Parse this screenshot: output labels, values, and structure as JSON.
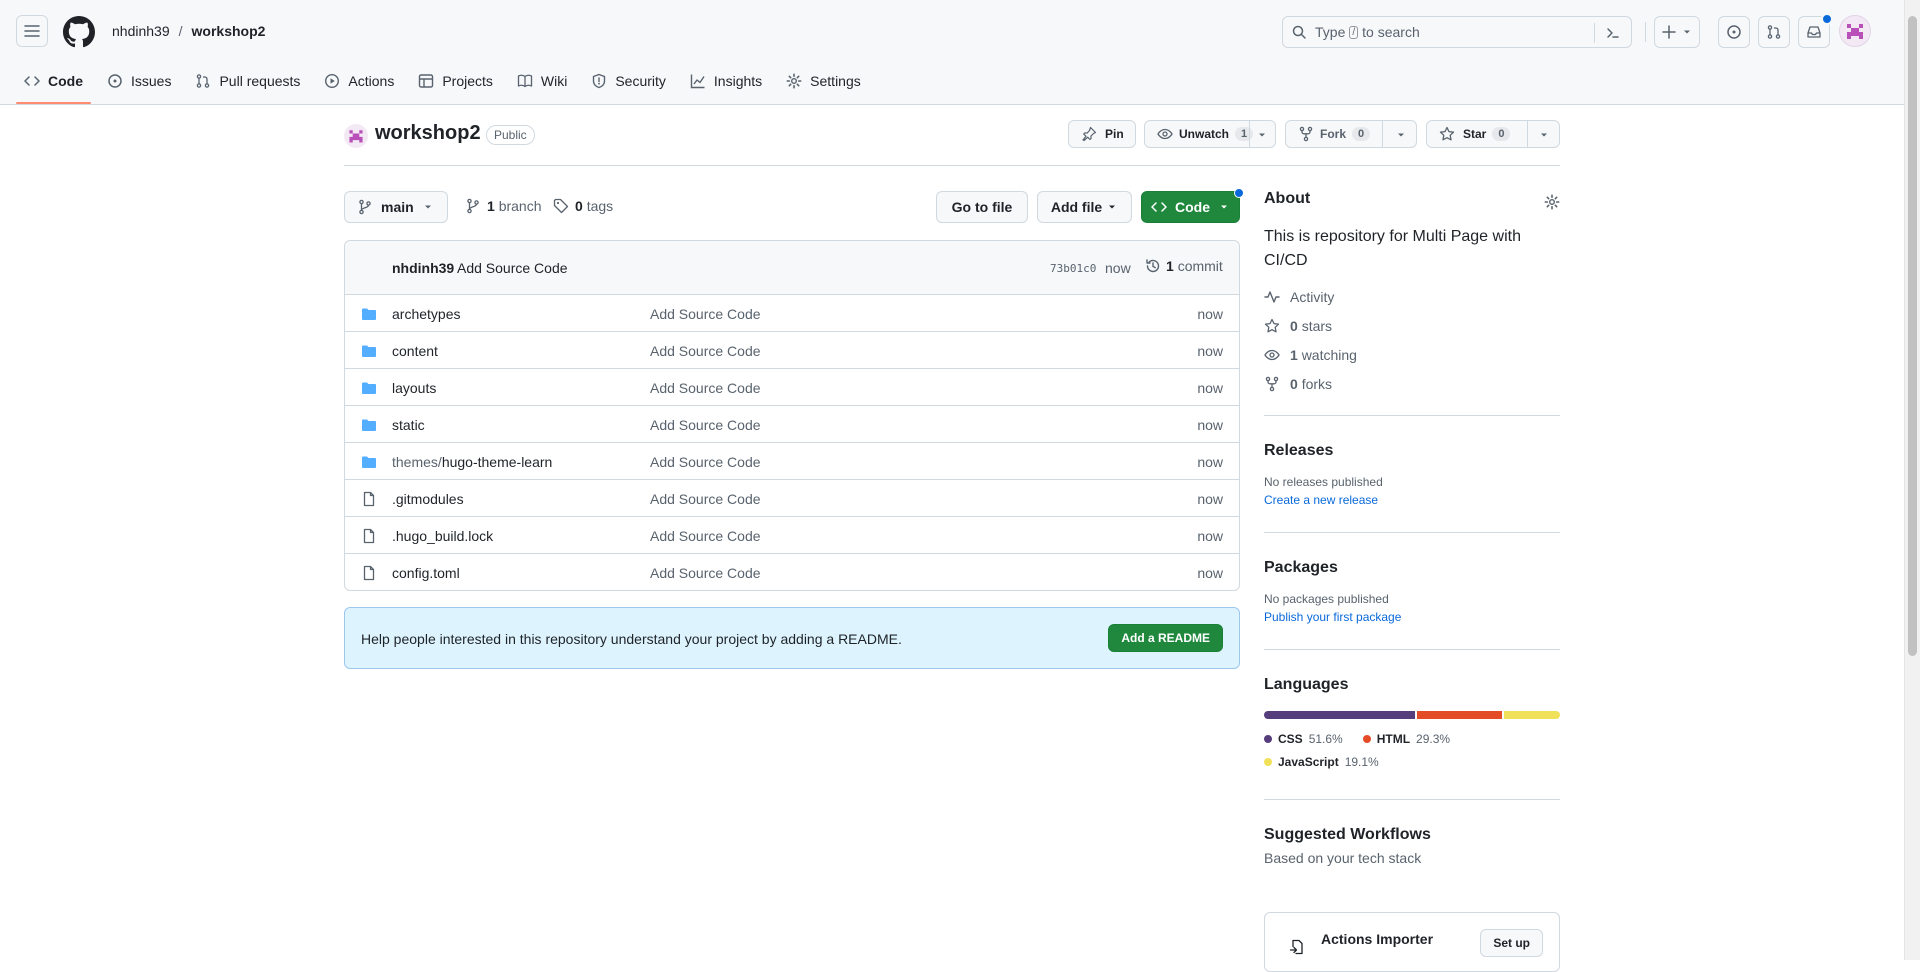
{
  "header": {
    "owner": "nhdinh39",
    "separator": "/",
    "repo": "workshop2",
    "search": {
      "text_before": "Type",
      "key": "/",
      "text_after": "to search"
    },
    "icons": [
      "hamburger-icon",
      "github-logo",
      "terminal-icon",
      "plus-icon",
      "issue-icon",
      "pull-request-icon",
      "inbox-icon",
      "avatar"
    ]
  },
  "nav": {
    "code": "Code",
    "issues": "Issues",
    "pulls": "Pull requests",
    "actions": "Actions",
    "projects": "Projects",
    "wiki": "Wiki",
    "security": "Security",
    "insights": "Insights",
    "settings": "Settings"
  },
  "repo": {
    "title": "workshop2",
    "visibility": "Public",
    "pin": "Pin",
    "unwatch": "Unwatch",
    "watch_count": "1",
    "fork": "Fork",
    "fork_count": "0",
    "star": "Star",
    "star_count": "0"
  },
  "branchbar": {
    "branch": "main",
    "branches_count": "1",
    "branches_label": "branch",
    "tags_count": "0",
    "tags_label": "tags",
    "go_to_file": "Go to file",
    "add_file": "Add file",
    "code": "Code"
  },
  "commit": {
    "author": "nhdinh39",
    "message": "Add Source Code",
    "sha": "73b01c0",
    "time": "now",
    "count": "1",
    "count_label": "commit"
  },
  "files": [
    {
      "type": "dir",
      "prefix": "",
      "name": "archetypes",
      "message": "Add Source Code",
      "time": "now"
    },
    {
      "type": "dir",
      "prefix": "",
      "name": "content",
      "message": "Add Source Code",
      "time": "now"
    },
    {
      "type": "dir",
      "prefix": "",
      "name": "layouts",
      "message": "Add Source Code",
      "time": "now"
    },
    {
      "type": "dir",
      "prefix": "",
      "name": "static",
      "message": "Add Source Code",
      "time": "now"
    },
    {
      "type": "dir",
      "prefix": "themes/",
      "name": "hugo-theme-learn",
      "message": "Add Source Code",
      "time": "now"
    },
    {
      "type": "file",
      "prefix": "",
      "name": ".gitmodules",
      "message": "Add Source Code",
      "time": "now"
    },
    {
      "type": "file",
      "prefix": "",
      "name": ".hugo_build.lock",
      "message": "Add Source Code",
      "time": "now"
    },
    {
      "type": "file",
      "prefix": "",
      "name": "config.toml",
      "message": "Add Source Code",
      "time": "now"
    }
  ],
  "readme": {
    "text": "Help people interested in this repository understand your project by adding a README.",
    "button": "Add a README"
  },
  "about": {
    "heading": "About",
    "description": "This is repository for Multi Page with CI/CD",
    "activity": "Activity",
    "stars_count": "0",
    "stars_label": "stars",
    "watching_count": "1",
    "watching_label": "watching",
    "forks_count": "0",
    "forks_label": "forks"
  },
  "releases": {
    "heading": "Releases",
    "empty": "No releases published",
    "link": "Create a new release"
  },
  "packages": {
    "heading": "Packages",
    "empty": "No packages published",
    "link": "Publish your first package"
  },
  "languages": {
    "heading": "Languages",
    "items": [
      {
        "name": "CSS",
        "percent": "51.6%",
        "value": 51.6,
        "color": "#563d7c"
      },
      {
        "name": "HTML",
        "percent": "29.3%",
        "value": 29.3,
        "color": "#e34c26"
      },
      {
        "name": "JavaScript",
        "percent": "19.1%",
        "value": 19.1,
        "color": "#f1e05a"
      }
    ]
  },
  "workflows": {
    "heading": "Suggested Workflows",
    "subheading": "Based on your tech stack",
    "card_title": "Actions Importer",
    "setup": "Set up"
  },
  "colors": {
    "accent_green": "#1f883d",
    "link_blue": "#0969da",
    "nav_underline": "#fd8c73",
    "folder_blue": "#54aeff"
  }
}
